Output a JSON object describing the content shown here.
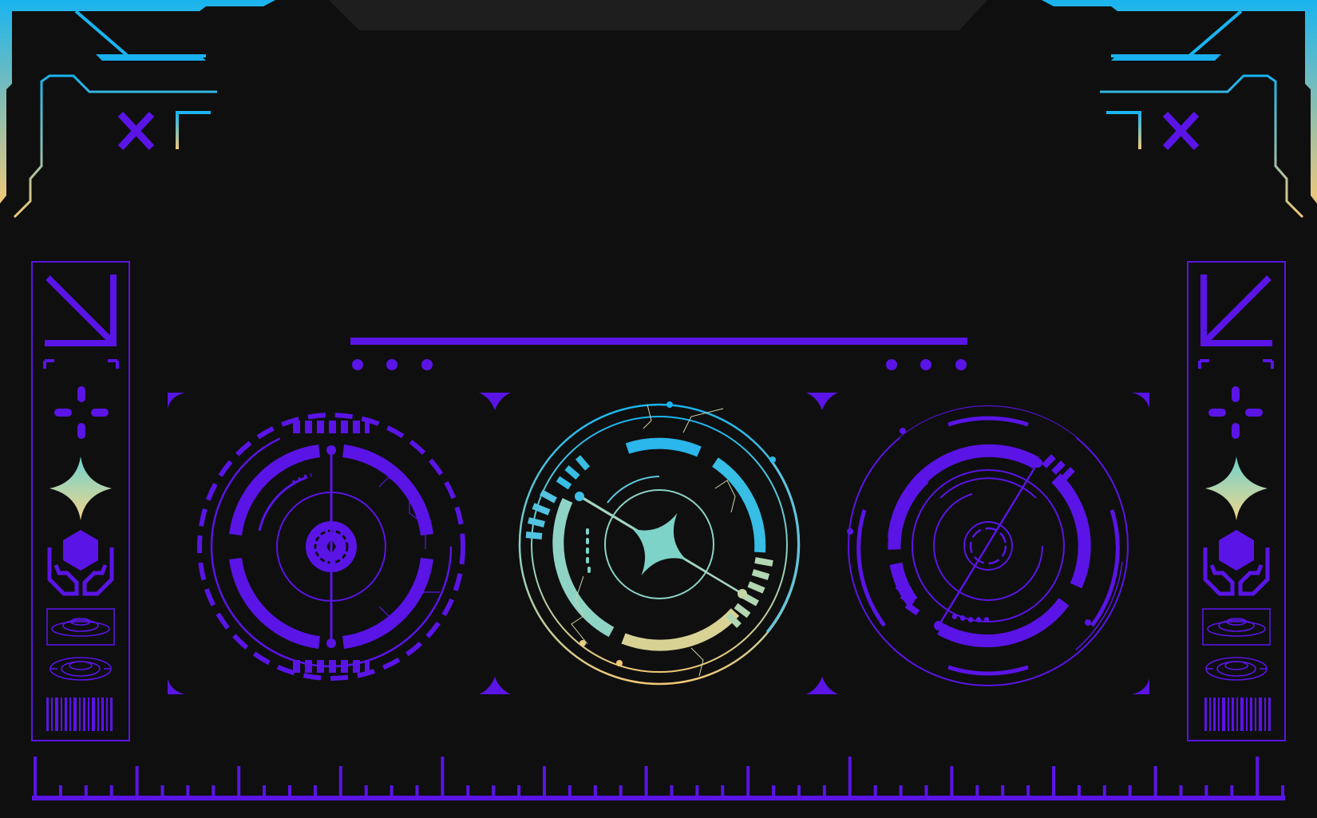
{
  "colors": {
    "background": "#0f0f0f",
    "panel_top": "#1e1e1e",
    "accent_primary": "#5a14e6",
    "accent_cyan": "#19b4f0",
    "accent_sand": "#f0c878",
    "accent_teal": "#7dd3c8"
  },
  "icons": {
    "left_panel": [
      "diagonal-arrow-icon",
      "crosshair-icon",
      "sparkle-star-icon",
      "hexagon-hands-icon",
      "ring-target-icon",
      "ring-target-icon",
      "barcode-icon"
    ],
    "right_panel": [
      "diagonal-arrow-icon",
      "crosshair-icon",
      "sparkle-star-icon",
      "hexagon-hands-icon",
      "ring-target-icon",
      "ring-target-icon",
      "barcode-icon"
    ],
    "top_left": [
      "close-x-icon",
      "corner-bracket-icon"
    ],
    "top_right": [
      "close-x-icon",
      "corner-bracket-icon"
    ],
    "dials": [
      "radar-dial-left",
      "radar-dial-center",
      "radar-dial-right"
    ],
    "bottom": "ruler-scale"
  }
}
